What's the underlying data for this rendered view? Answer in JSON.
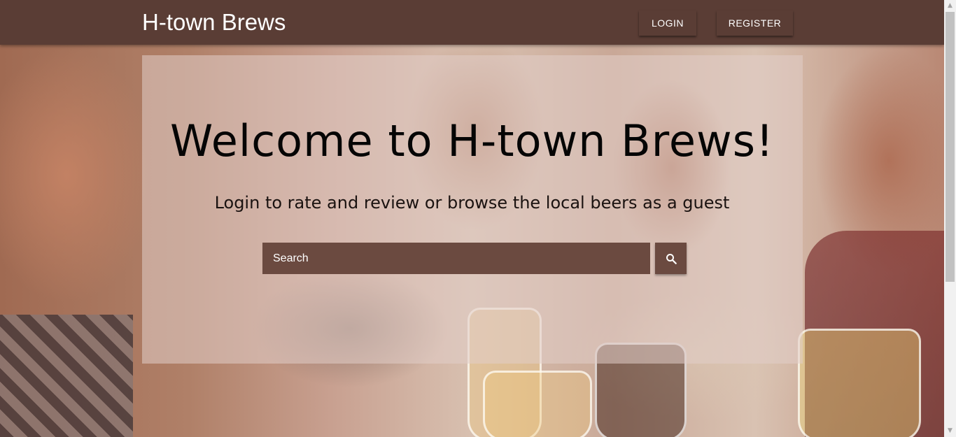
{
  "navbar": {
    "brand": "H-town Brews",
    "login_label": "LOGIN",
    "register_label": "REGISTER"
  },
  "hero": {
    "title": "Welcome to H-town Brews!",
    "subtitle": "Login to rate and review or browse the local beers as a guest"
  },
  "search": {
    "placeholder": "Search",
    "button_icon": "search-icon"
  },
  "colors": {
    "navbar": "#5a3d35",
    "search_bg": "#6b4a40",
    "hero_overlay": "rgba(225,205,200,0.55)"
  }
}
